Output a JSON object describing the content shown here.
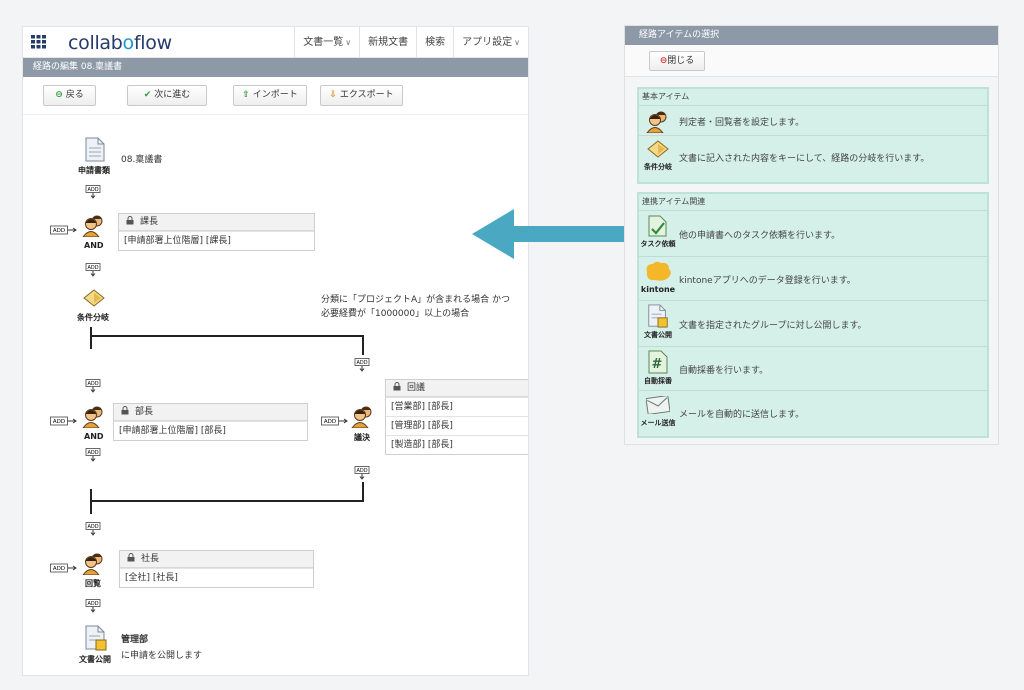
{
  "app": {
    "logo_prefix": "collab",
    "logo_oo": "o",
    "logo_suffix": "flow",
    "nav": [
      {
        "label": "文書一覧",
        "caret": "∨"
      },
      {
        "label": "新規文書"
      },
      {
        "label": "検索"
      },
      {
        "label": "アプリ設定",
        "caret": "∨"
      }
    ],
    "edit_title": "経路の編集 08.稟議書"
  },
  "toolbar": {
    "back": "戻る",
    "next": "次に進む",
    "import": "インポート",
    "export": "エクスポート"
  },
  "add_label": "ADD",
  "flow": {
    "start_label": "申請書類",
    "start_doc": "08.稟議書",
    "approver1": {
      "node_label": "AND",
      "title": "課長",
      "rows": [
        "[申請部署上位階層] [課長]"
      ]
    },
    "branch_label": "条件分岐",
    "branch_condition_line1": "分類に「プロジェクトA」が含まれる場合 かつ",
    "branch_condition_line2": "必要経費が「1000000」以上の場合",
    "approver2": {
      "node_label": "AND",
      "title": "部長",
      "rows": [
        "[申請部署上位階層] [部長]"
      ]
    },
    "approver3": {
      "node_label": "議決",
      "title": "回議",
      "rows": [
        "[営業部] [部長]",
        "[管理部] [部長]",
        "[製造部] [部長]"
      ]
    },
    "approver4": {
      "node_label": "回覧",
      "title": "社長",
      "rows": [
        "[全社] [社長]"
      ]
    },
    "publish_label": "文書公開",
    "publish_dept": "管理部",
    "publish_text": "に申請を公開します"
  },
  "panel": {
    "title": "経路アイテムの選択",
    "close_label": "閉じる",
    "basic": {
      "title": "基本アイテム",
      "items": [
        {
          "icon_name": "approver-icon",
          "label": "",
          "desc": "判定者・回覧者を設定します。"
        },
        {
          "icon_name": "branch-icon",
          "label": "条件分岐",
          "desc": "文書に記入された内容をキーにして、経路の分岐を行います。"
        }
      ]
    },
    "integration": {
      "title": "連携アイテム関連",
      "items": [
        {
          "icon_name": "task-request-icon",
          "label": "タスク依頼",
          "desc": "他の申請書へのタスク依頼を行います。"
        },
        {
          "icon_name": "kintone-icon",
          "label": "kintone",
          "desc": "kintoneアプリへのデータ登録を行います。"
        },
        {
          "icon_name": "document-publish-icon",
          "label": "文書公開",
          "desc": "文書を指定されたグループに対し公開します。"
        },
        {
          "icon_name": "auto-number-icon",
          "label": "自動採番",
          "desc": "自動採番を行います。"
        },
        {
          "icon_name": "mail-icon",
          "label": "メール送信",
          "desc": "メールを自動的に送信します。"
        }
      ]
    }
  },
  "colors": {
    "header_bar": "#8e99a8",
    "panel_group_bg": "#d5efe9",
    "arrow": "#4aa8c3",
    "logo_dark": "#263b68",
    "logo_accent": "#1f97c7"
  }
}
